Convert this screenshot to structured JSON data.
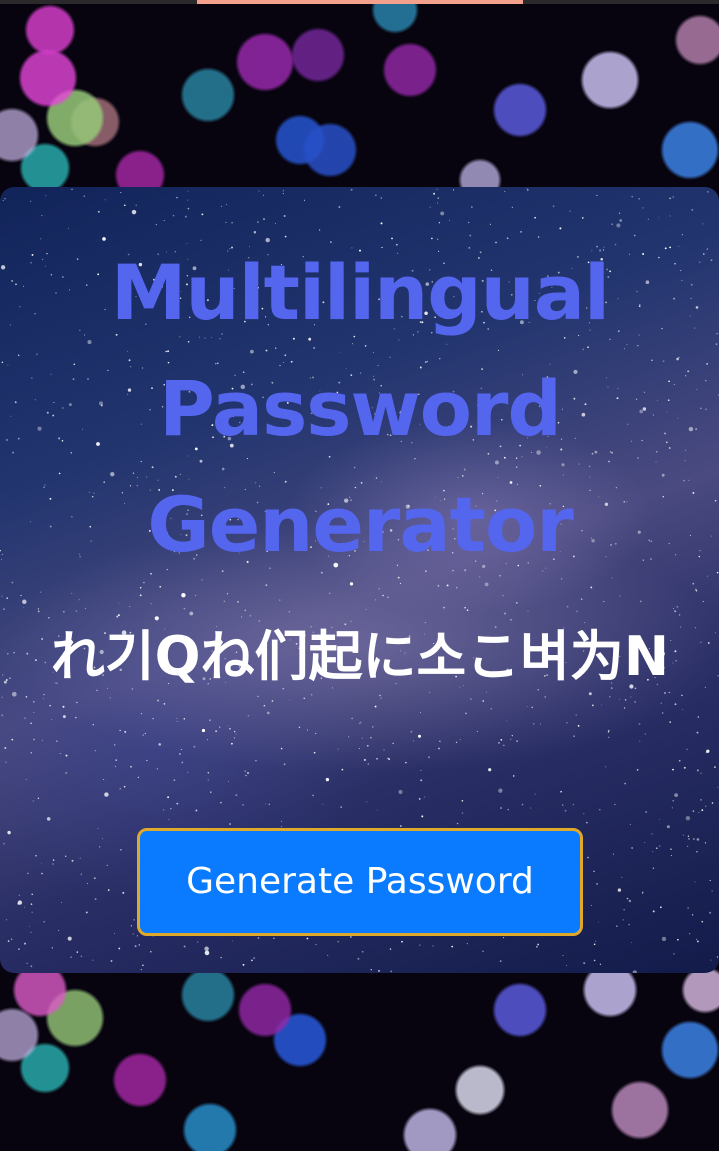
{
  "app": {
    "title": "Multilingual Password Generator",
    "password": "れ기Qね们起に소こ벼为N",
    "button_label": "Generate Password"
  },
  "colors": {
    "title": "#5566ee",
    "password": "#ffffff",
    "button_bg": "#0a7bff",
    "button_border": "#e1a92a",
    "top_accent": "#f3a08c"
  }
}
